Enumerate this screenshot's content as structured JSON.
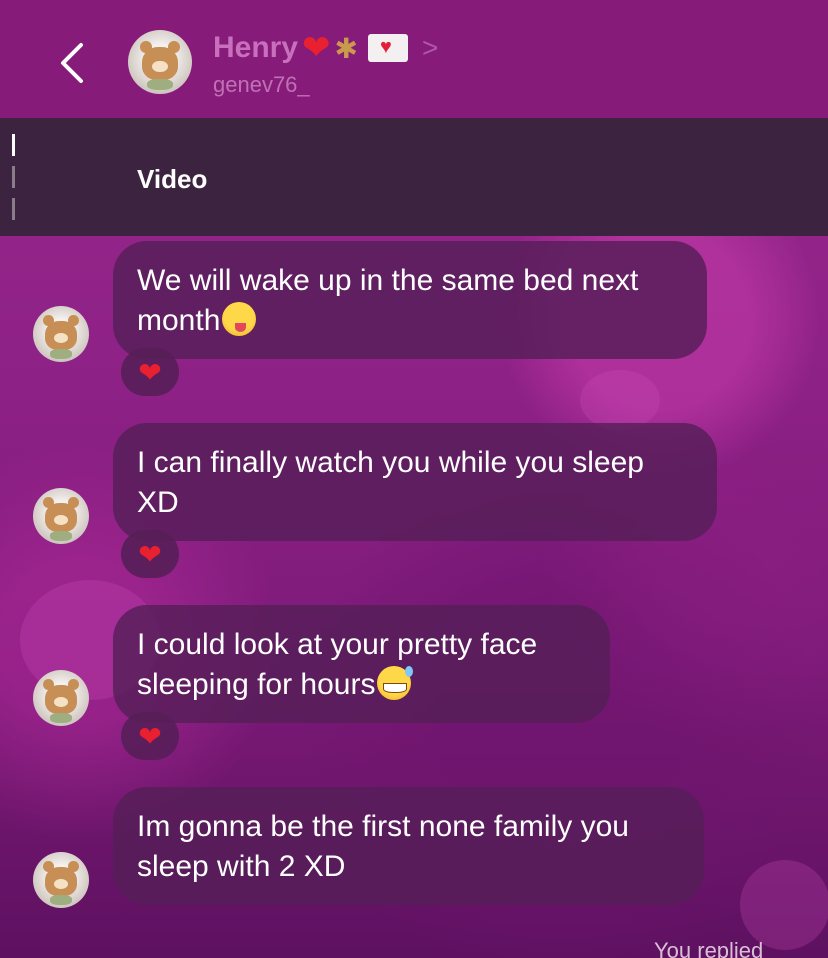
{
  "header": {
    "back_icon": "chevron-left-icon",
    "contact_name": "Henry",
    "name_emojis": [
      "red-heart",
      "ringed-planet",
      "love-letter"
    ],
    "chevron": ">",
    "username": "genev76_"
  },
  "video_bar": {
    "label": "Video"
  },
  "messages": [
    {
      "text": "We will wake up in the same bed next month",
      "emoji": "face-savoring-food",
      "reaction": "❤"
    },
    {
      "text": "I can finally watch you while you sleep XD",
      "emoji": "",
      "reaction": "❤"
    },
    {
      "text": "I could look at your pretty face sleeping for hours",
      "emoji": "grinning-face-with-sweat",
      "reaction": "❤"
    },
    {
      "text": "Im gonna be the first none family you sleep with 2 XD",
      "emoji": "",
      "reaction": ""
    }
  ],
  "footer": {
    "replied_text": "You replied"
  },
  "colors": {
    "header_bg": "#861b79",
    "video_bar_bg": "#3c2340",
    "bubble_bg": "#561e58",
    "reaction_heart": "#e8202f"
  }
}
